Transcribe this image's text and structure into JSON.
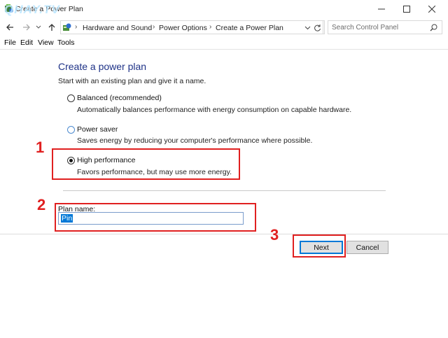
{
  "window": {
    "title": "Create a Power Plan",
    "watermark": "QHAY.TV",
    "controls": {
      "minimize": "minimize-icon",
      "maximize": "maximize-icon",
      "close": "close-icon"
    }
  },
  "address": {
    "crumbs": [
      "Hardware and Sound",
      "Power Options",
      "Create a Power Plan"
    ],
    "search_placeholder": "Search Control Panel"
  },
  "menu": [
    "File",
    "Edit",
    "View",
    "Tools"
  ],
  "content": {
    "heading": "Create a power plan",
    "intro": "Start with an existing plan and give it a name.",
    "options": [
      {
        "label": "Balanced (recommended)",
        "desc": "Automatically balances performance with energy consumption on capable hardware.",
        "checked": false
      },
      {
        "label": "Power saver",
        "desc": "Saves energy by reducing your computer's performance where possible.",
        "checked": false
      },
      {
        "label": "High performance",
        "desc": "Favors performance, but may use more energy.",
        "checked": true
      }
    ],
    "plan_name_label": "Plan name:",
    "plan_name_value": "Pin"
  },
  "buttons": {
    "next": "Next",
    "cancel": "Cancel"
  },
  "annotations": {
    "one": "1",
    "two": "2",
    "three": "3"
  },
  "colors": {
    "heading": "#1e3287",
    "annotation": "#e02020",
    "selection": "#0078d7"
  }
}
